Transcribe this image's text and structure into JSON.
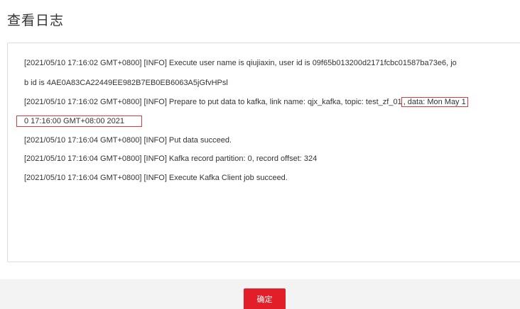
{
  "dialog": {
    "title": "查看日志"
  },
  "log": {
    "line1": "[2021/05/10 17:16:02 GMT+0800] [INFO] Execute user name is qiujiaxin, user id is 09f65b013200d2171fcbc01587ba73e6, jo",
    "line2": "b id is 4AE0A83CA22449EE982B7EB0EB6063A5jGfvHPsl",
    "line3_main": "[2021/05/10 17:16:02 GMT+0800] [INFO] Prepare to put data to kafka, link name: qjx_kafka, topic: test_zf_01",
    "line3_highlight": ", data: Mon May 1",
    "line4_highlight": "0 17:16:00 GMT+08:00 2021",
    "line5": "[2021/05/10 17:16:04 GMT+0800] [INFO] Put data succeed.",
    "line6": "[2021/05/10 17:16:04 GMT+0800] [INFO] Kafka record partition: 0, record offset: 324",
    "line7": "[2021/05/10 17:16:04 GMT+0800] [INFO] Execute Kafka Client job succeed."
  },
  "footer": {
    "ok_label": "确定"
  },
  "colors": {
    "accent": "#e21f28",
    "highlight_border": "#e4393c"
  }
}
